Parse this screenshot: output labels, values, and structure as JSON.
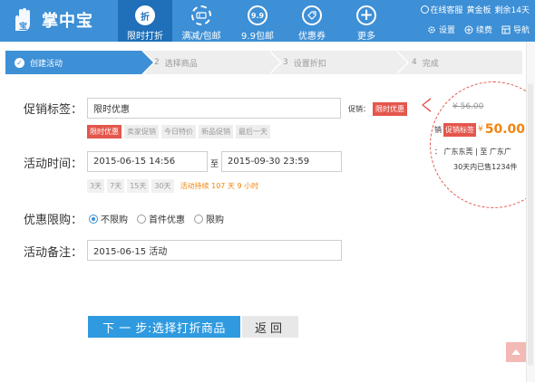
{
  "app": {
    "title": "掌中宝",
    "colors": {
      "brand": "#3d8fd6",
      "nav_active": "#1f6fb9",
      "accent_red": "#e4564c",
      "accent_orange": "#f0850f",
      "next_button": "#2f9ae0"
    }
  },
  "nav": {
    "items": [
      {
        "label": "限时打折",
        "icon_text": "折",
        "icon": "discount-icon"
      },
      {
        "label": "满减/包邮",
        "icon_text": "",
        "icon": "full-reduction-icon"
      },
      {
        "label": "9.9包邮",
        "icon_text": "9.9",
        "icon": "free-shipping-icon"
      },
      {
        "label": "优惠券",
        "icon_text": "",
        "icon": "coupon-icon"
      },
      {
        "label": "更多",
        "icon_text": "+",
        "icon": "plus-icon"
      }
    ]
  },
  "top_right": {
    "service": "在线客服",
    "version": "黄金板",
    "remaining": "剩余14天",
    "settings": "设置",
    "renew": "续费",
    "guide": "导航"
  },
  "steps": [
    {
      "num": "",
      "label": "创建活动"
    },
    {
      "num": "2",
      "label": "选择商品"
    },
    {
      "num": "3",
      "label": "设置折扣"
    },
    {
      "num": "4",
      "label": "完成"
    }
  ],
  "form": {
    "promo_tag": {
      "label": "促销标签：",
      "value": "限时优惠",
      "preview_label": "促销：",
      "preview_value": "限时优惠",
      "options": [
        "限时优惠",
        "卖家促销",
        "今日特价",
        "新品促销",
        "最后一天"
      ]
    },
    "activity_time": {
      "label": "活动时间：",
      "start": "2015-06-15 14:56",
      "separator": "至",
      "end": "2015-09-30 23:59",
      "day_options": [
        "3天",
        "7天",
        "15天",
        "30天"
      ],
      "duration": "活动持续 107 天 9 小时"
    },
    "limit": {
      "label": "优惠限购：",
      "options": [
        "不限购",
        "首件优惠",
        "限购"
      ],
      "selected": "不限购"
    },
    "note": {
      "label": "活动备注：",
      "value": "2015-06-15 活动"
    }
  },
  "buttons": {
    "next": "下 一 步:选择打折商品",
    "back": "返回"
  },
  "preview": {
    "original_price": "¥ 56.00",
    "prefix": "销",
    "badge": "促销标签",
    "yen": "¥",
    "price": "50.00",
    "location": "广东东莞 | 至 广东广",
    "location_prefix": "：",
    "sold": "30天内已售1234件"
  }
}
